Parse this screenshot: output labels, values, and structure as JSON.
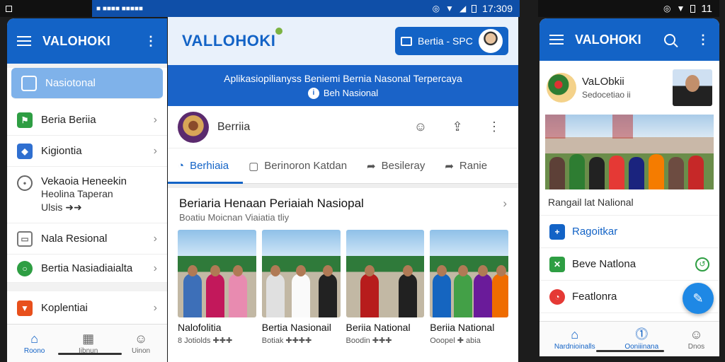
{
  "status": {
    "left_label": "",
    "mid_left": "■ ■■■■ ■■■■■",
    "mid_time": "17:309",
    "right_time": "11"
  },
  "left": {
    "app_title": "VALOHOKI",
    "active_item": "Nasiotonal",
    "items": [
      {
        "label": "Beria Beriia",
        "color": "#2e9e43",
        "icon": "flag-icon"
      },
      {
        "label": "Kigiontia",
        "color": "#2f6fd0",
        "icon": "diamond-icon"
      },
      {
        "label": "Vekaoia Heneekin",
        "sub1": "Heolina Taperan",
        "sub2": "Ulsis ➜➜",
        "color": "#666666",
        "icon": "pin-icon"
      },
      {
        "label": "Nala Resional",
        "color": "#777777",
        "icon": "inbox-icon"
      },
      {
        "label": "Bertia Nasiadiaialta",
        "color": "#2e9e43",
        "icon": "circle-icon"
      },
      {
        "label": "Koplentiai",
        "color": "#e8501c",
        "icon": "bookmark-icon"
      }
    ],
    "bottom_nav": [
      "Roono",
      "Iibnun",
      "Uinon"
    ]
  },
  "mid": {
    "logo": "VALLOHOKI",
    "top_button": "Bertia - SPC",
    "banner_title": "Aplikasiopilianyss Beniemi Bernia Nasonal Terpercaya",
    "banner_sub": "Beh Nasional",
    "profile_name": "Berriia",
    "user_label": "",
    "tabs": [
      "Berhiaia",
      "Berinoron Katdan",
      "Besileray",
      "Ranie"
    ],
    "card_title": "Beriaria Henaan Periaiah Nasiopal",
    "card_sub": "Boatiu Moicnan Viaiatia tliy",
    "captions": [
      "Nalofolitia",
      "Bertia Nasionail",
      "Beriia National",
      "Beriia National"
    ],
    "metas": [
      "8 Jotiolds ✚✚✚",
      "Botiak ✚✚✚✚",
      "Boodin ✚✚✚",
      "Ooopel ✚ abia"
    ]
  },
  "right": {
    "app_title": "VALOHOKI",
    "name": "VaLObkii",
    "sub": "Sedocetiao ii",
    "caption": "Rangail lat Nalional",
    "items": [
      {
        "label": "Ragoitkar",
        "blue": true,
        "icon": "plus-icon",
        "color": "#1363c6"
      },
      {
        "label": "Beve Natlona",
        "blue": false,
        "icon": "x-icon",
        "color": "#2e9e43"
      },
      {
        "label": "Featlonra",
        "blue": false,
        "icon": "flag-icon",
        "color": "#e53935"
      }
    ],
    "bottom_nav": [
      "Nardnioinalls",
      "Ooniiinana",
      "Dnos"
    ]
  },
  "colors": {
    "primary": "#1363c6",
    "banner": "#1a63c8",
    "active_item": "#7fb2ea"
  }
}
